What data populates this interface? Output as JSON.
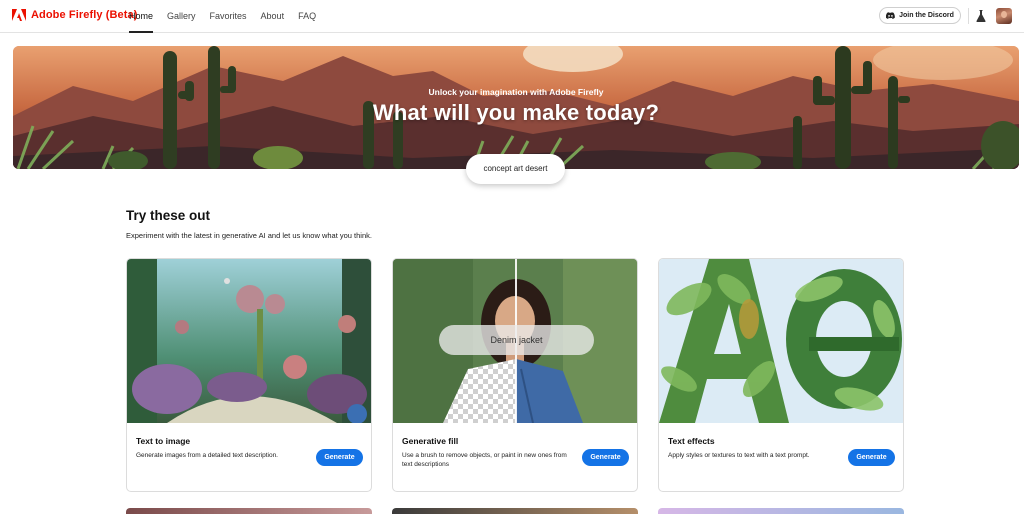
{
  "brand": {
    "name": "Adobe Firefly (Beta)",
    "logo_icon": "adobe-logo-icon",
    "color": "#eb1000"
  },
  "nav": {
    "items": [
      {
        "label": "Home",
        "active": true
      },
      {
        "label": "Gallery",
        "active": false
      },
      {
        "label": "Favorites",
        "active": false
      },
      {
        "label": "About",
        "active": false
      },
      {
        "label": "FAQ",
        "active": false
      }
    ]
  },
  "header_actions": {
    "discord_label": "Join the Discord",
    "discord_icon": "discord-icon",
    "lab_icon": "flask-icon",
    "avatar_icon": "user-avatar"
  },
  "hero": {
    "subtitle": "Unlock your imagination with Adobe Firefly",
    "title": "What will you make today?",
    "search_value": "concept art desert"
  },
  "section": {
    "title": "Try these out",
    "description": "Experiment with the latest in generative AI and let us know what you think."
  },
  "cards": [
    {
      "title": "Text to image",
      "description": "Generate images from a detailed text description.",
      "button": "Generate"
    },
    {
      "title": "Generative fill",
      "description": "Use a brush to remove objects, or paint in new ones from text descriptions",
      "button": "Generate",
      "overlay_text": "Denim jacket"
    },
    {
      "title": "Text effects",
      "description": "Apply styles or textures to text with a text prompt.",
      "button": "Generate"
    }
  ],
  "colors": {
    "accent": "#1473e6",
    "brand": "#eb1000"
  }
}
